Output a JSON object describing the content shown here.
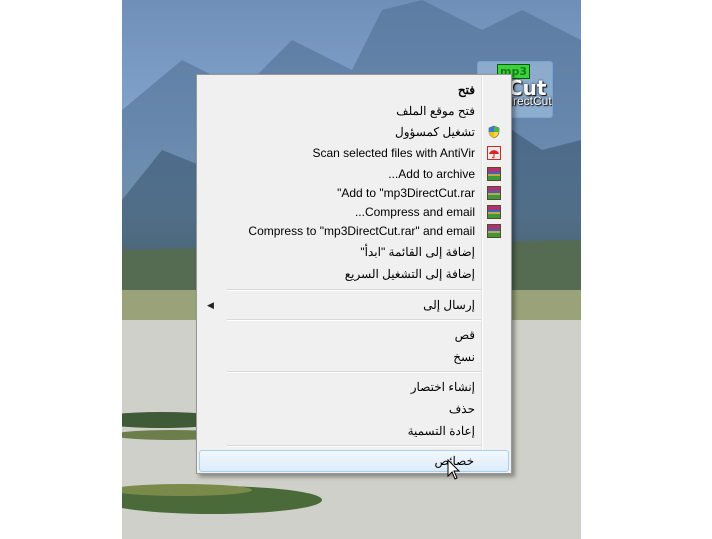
{
  "desktop_icon": {
    "label": "mp3DirectCut",
    "badge": "mp3",
    "badge_sub": "Cut"
  },
  "menu": {
    "items": [
      {
        "label": "فتح",
        "bold": true
      },
      {
        "label": "فتح موقع الملف"
      },
      {
        "label": "تشغيل كمسؤول",
        "icon": "uac-shield-icon"
      },
      {
        "label": "Scan selected files with AntiVir",
        "icon": "antivir-umbrella-icon"
      },
      {
        "label": "Add to archive...",
        "icon": "winrar-icon"
      },
      {
        "label": "Add to \"mp3DirectCut.rar\"",
        "icon": "winrar-icon"
      },
      {
        "label": "Compress and email...",
        "icon": "winrar-icon"
      },
      {
        "label": "Compress to \"mp3DirectCut.rar\" and email",
        "icon": "winrar-icon"
      },
      {
        "label": "إضافة إلى القائمة \"ابدأ\""
      },
      {
        "label": "إضافة إلى التشغيل السريع"
      },
      {
        "label": "إرسال إلى",
        "submenu": true
      },
      {
        "label": "قص"
      },
      {
        "label": "نسخ"
      },
      {
        "label": "إنشاء اختصار"
      },
      {
        "label": "حذف"
      },
      {
        "label": "إعادة التسمية"
      },
      {
        "label": "خصائص",
        "selected": true
      }
    ]
  },
  "colors": {
    "menu_bg": "#f0f0f0",
    "highlight": "#dcebfa",
    "highlight_border": "#a8cfef"
  }
}
